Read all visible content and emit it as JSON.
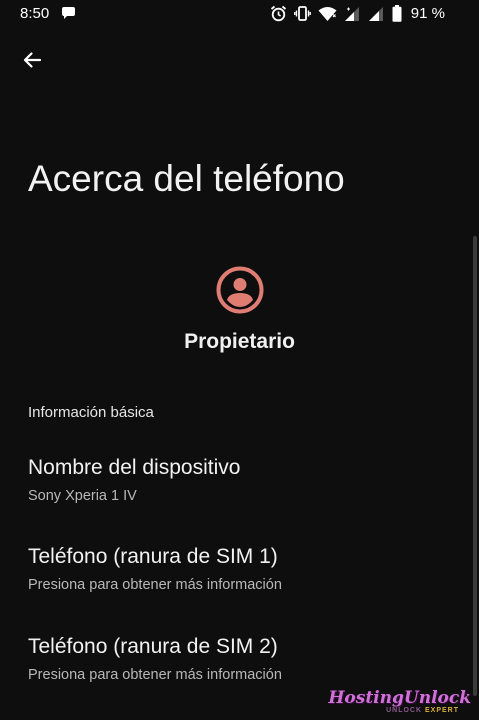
{
  "status_bar": {
    "time": "8:50",
    "battery_text": "91 %",
    "icons": [
      "chat-bubble-icon",
      "alarm-icon",
      "vibrate-icon",
      "wifi-icon",
      "signal-icon",
      "signal-icon",
      "battery-icon"
    ]
  },
  "header": {
    "back_icon": "arrow-left-icon",
    "title": "Acerca del teléfono"
  },
  "owner": {
    "avatar_icon": "account-circle-icon",
    "avatar_color": "#e07d73",
    "name": "Propietario"
  },
  "section": {
    "header": "Información básica",
    "items": [
      {
        "title": "Nombre del dispositivo",
        "summary": "Sony Xperia 1 IV"
      },
      {
        "title": "Teléfono (ranura de SIM 1)",
        "summary": "Presiona para obtener más información"
      },
      {
        "title": "Teléfono (ranura de SIM 2)",
        "summary": "Presiona para obtener más información"
      }
    ]
  },
  "watermark": {
    "main": "HostingUnlock",
    "sub_left": "UNLOCK",
    "sub_right": "EXPERT"
  }
}
